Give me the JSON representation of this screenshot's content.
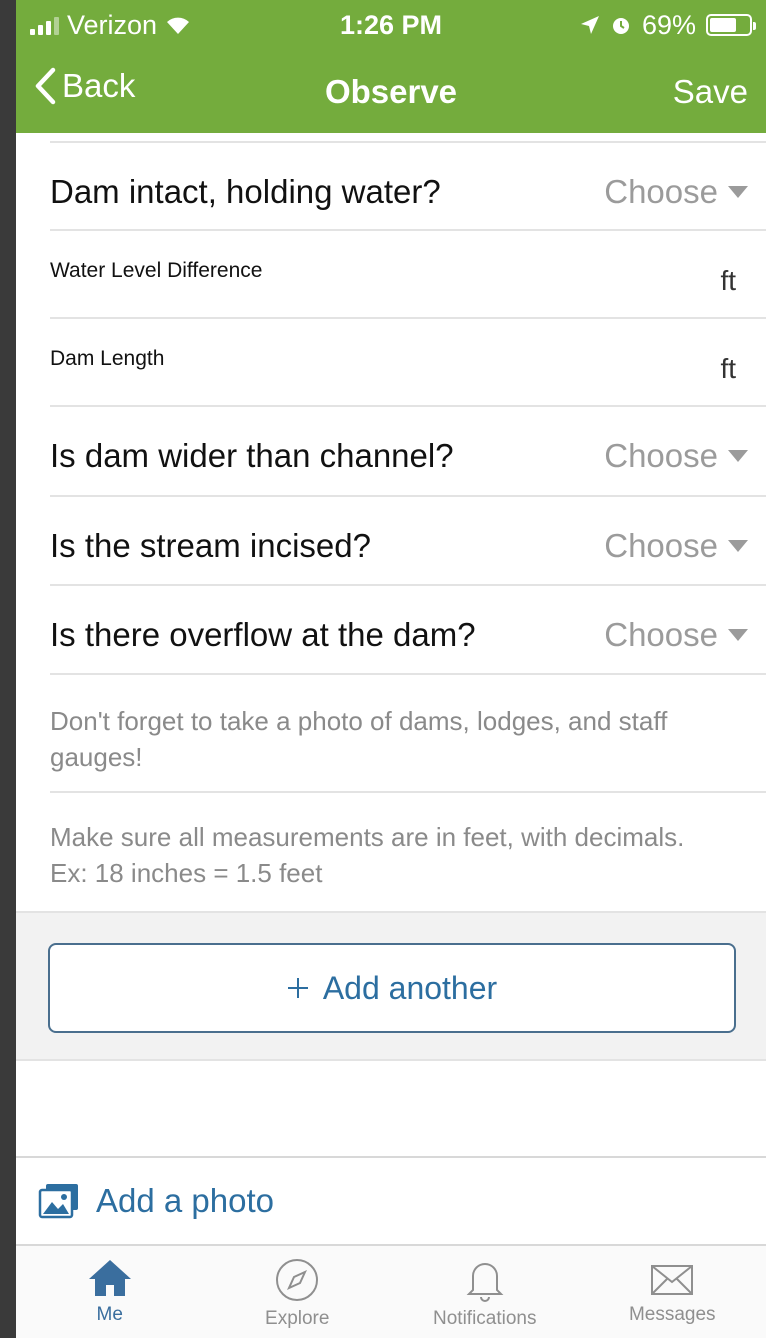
{
  "status_bar": {
    "carrier": "Verizon",
    "time": "1:26 PM",
    "battery": "69%",
    "battery_level": 0.69
  },
  "nav": {
    "back_label": "Back",
    "title": "Observe",
    "save_label": "Save"
  },
  "fields": [
    {
      "label": "Dam intact, holding water?",
      "value": "Choose"
    },
    {
      "label": "Water Level Difference",
      "unit": "ft"
    },
    {
      "label": "Dam Length",
      "unit": "ft"
    },
    {
      "label": "Is dam wider than channel?",
      "value": "Choose"
    },
    {
      "label": "Is the stream incised?",
      "value": "Choose"
    },
    {
      "label": "Is there overflow at the dam?",
      "value": "Choose"
    }
  ],
  "notes": [
    "Don't forget to take a photo of dams, lodges, and staff gauges!",
    "Make sure all measurements are in feet, with decimals. Ex: 18 inches = 1.5 feet"
  ],
  "add_another_label": "Add another",
  "add_photo_label": "Add a photo",
  "tabs": [
    {
      "label": "Me",
      "icon": "home-icon",
      "active": true
    },
    {
      "label": "Explore",
      "icon": "compass-icon"
    },
    {
      "label": "Notifications",
      "icon": "bell-icon"
    },
    {
      "label": "Messages",
      "icon": "envelope-icon"
    }
  ],
  "colors": {
    "header": "#74ac3d",
    "accent": "#2c6ea0",
    "muted": "#9b9b9b"
  }
}
